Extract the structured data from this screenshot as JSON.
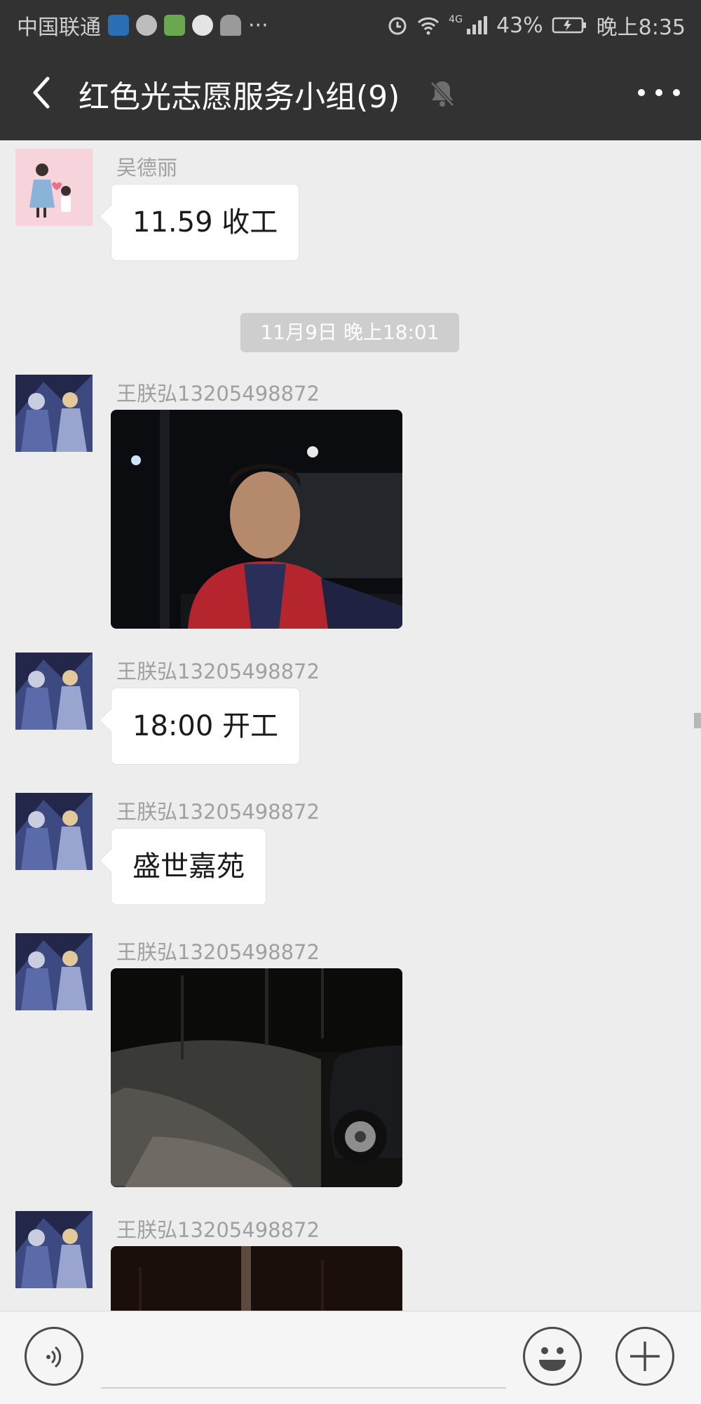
{
  "status": {
    "carrier": "中国联通",
    "battery": "43%",
    "time": "晚上8:35",
    "network": "4G",
    "more_notifications": "···"
  },
  "header": {
    "title": "红色光志愿服务小组(9)",
    "icons": {
      "back": "chevron-left-icon",
      "mute": "bell-mute-icon",
      "more": "more-dots-icon"
    }
  },
  "messages": [
    {
      "sender": "吴德丽",
      "type": "text",
      "text": "11.59 收工"
    },
    {
      "sender": "王朕弘13205498872",
      "type": "image",
      "description": ""
    },
    {
      "sender": "王朕弘13205498872",
      "type": "text",
      "text": "18:00 开工"
    },
    {
      "sender": "王朕弘13205498872",
      "type": "text",
      "text": "盛世嘉苑"
    },
    {
      "sender": "王朕弘13205498872",
      "type": "image",
      "description": ""
    },
    {
      "sender": "王朕弘13205498872",
      "type": "image",
      "description": ""
    }
  ],
  "timestamp": "11月9日 晚上18:01",
  "input": {
    "placeholder": "",
    "icons": {
      "voice": "voice-icon",
      "emoji": "emoji-icon",
      "plus": "plus-icon"
    }
  },
  "colors": {
    "titlebar": "#323232",
    "chat_bg": "#ededed",
    "bubble": "#ffffff"
  }
}
